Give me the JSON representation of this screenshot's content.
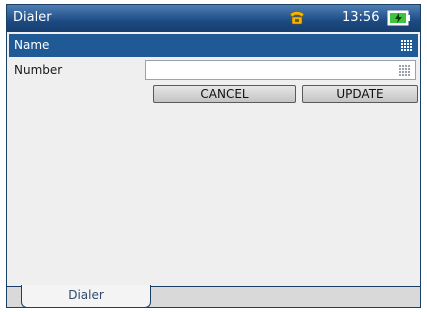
{
  "titlebar": {
    "title": "Dialer",
    "time": "13:56",
    "phone_icon": "phone-icon",
    "battery_icon": "battery-charging-icon"
  },
  "form": {
    "name_label": "Name",
    "number_label": "Number",
    "number_value": "",
    "keyboard_icon": "keyboard-icon"
  },
  "buttons": {
    "cancel_label": "CANCEL",
    "update_label": "UPDATE"
  },
  "tabs": [
    {
      "label": "Dialer",
      "selected": true
    }
  ],
  "colors": {
    "titlebar": "#1c4a82",
    "selected_row": "#1f5a96",
    "background": "#efefef",
    "phone_icon": "#f3b600",
    "battery_charge": "#3fc43f"
  }
}
